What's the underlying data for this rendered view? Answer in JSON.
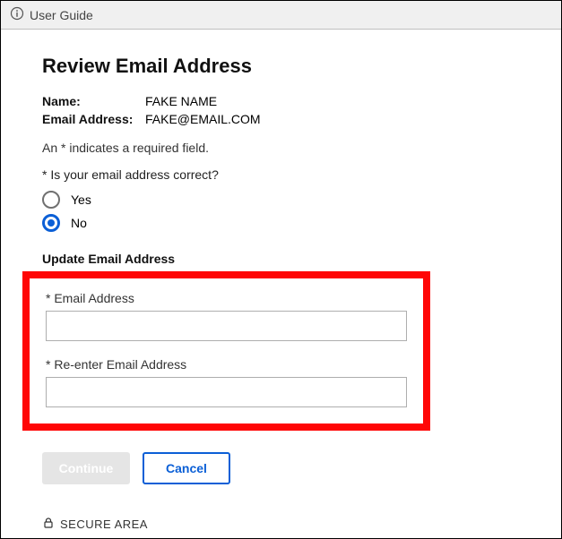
{
  "topbar": {
    "label": "User Guide"
  },
  "page": {
    "title": "Review Email Address"
  },
  "summary": {
    "name_label": "Name:",
    "name_value": "FAKE NAME",
    "email_label": "Email Address:",
    "email_value": "FAKE@EMAIL.COM"
  },
  "hint": "An * indicates a required field.",
  "question": {
    "text": "* Is your email address correct?",
    "options": {
      "yes": "Yes",
      "no": "No"
    },
    "selected": "no"
  },
  "update_section": {
    "heading": "Update Email Address",
    "fields": {
      "email": {
        "label": "* Email Address",
        "value": ""
      },
      "reenter": {
        "label": "* Re-enter Email Address",
        "value": ""
      }
    }
  },
  "buttons": {
    "continue": "Continue",
    "cancel": "Cancel"
  },
  "footer": {
    "secure": "SECURE AREA"
  }
}
